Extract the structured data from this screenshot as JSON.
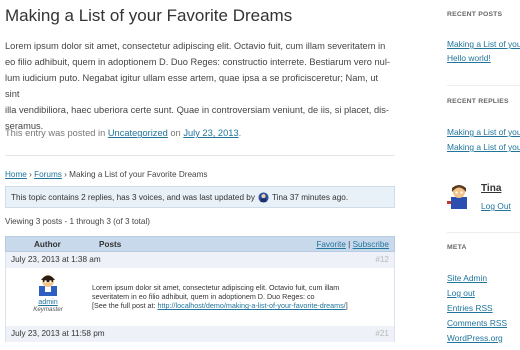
{
  "post": {
    "title": "Making a List of your Favorite Dreams",
    "body_lines": [
      "Lorem ipsum dolor sit amet, consectetur adipiscing elit. Octavio fuit, cum illam severitatem in",
      "eo filio adhibuit, quem in adoptionem D. Duo Reges: constructio interrete. Bestiarum vero nul-",
      "lum iudicium puto. Negabat igitur ullam esse artem, quae ipsa a se proficisceretur; Nam, ut sint",
      "illa vendibiliora, haec uberiora certe sunt. Quae in controversiam veniunt, de iis, si placet, dis-",
      "seramus."
    ],
    "meta_prefix": "This entry was posted in ",
    "category": "Uncategorized",
    "meta_on": " on ",
    "date": "July 23, 2013",
    "meta_end": "."
  },
  "breadcrumb": {
    "home": "Home",
    "sep": " › ",
    "forums": "Forums",
    "current": "Making a List of your Favorite Dreams"
  },
  "notice": {
    "text_before": "This topic contains 2 replies, has 3 voices, and was last updated by",
    "user": "Tina",
    "time": "37 minutes ago."
  },
  "viewing": "Viewing 3 posts - 1 through 3 (of 3 total)",
  "forum": {
    "col_author": "Author",
    "col_posts": "Posts",
    "favorite": "Favorite",
    "link_sep": " | ",
    "subscribe": "Subscribe",
    "replies": [
      {
        "date": "July 23, 2013 at 1:38 am",
        "num": "#12",
        "author": "admin",
        "role": "Keymaster",
        "lines": [
          "Lorem ipsum dolor sit amet, consectetur adipiscing elit. Octavio fuit, cum illam",
          "severitatem in eo filio adhibuit, quem in adoptionem D. Duo Reges: co"
        ],
        "see_prefix": "[See the full post at: ",
        "see_link": "http://localhost/demo/making-a-list-of-your-favorite-dreams/",
        "see_suffix": "]"
      },
      {
        "date": "July 23, 2013 at 11:58 pm",
        "num": "#21"
      }
    ]
  },
  "sidebar": {
    "recent_posts_title": "RECENT POSTS",
    "recent_posts": [
      "Making a List of you",
      "Hello world!"
    ],
    "recent_replies_title": "RECENT REPLIES",
    "recent_replies": [
      "Making a List of you",
      "Making a List of you"
    ],
    "user_name": "Tina",
    "logout": "Log Out",
    "meta_title": "META",
    "meta_links": [
      "Site Admin",
      "Log out",
      "Entries RSS",
      "Comments RSS",
      "WordPress.org"
    ]
  }
}
